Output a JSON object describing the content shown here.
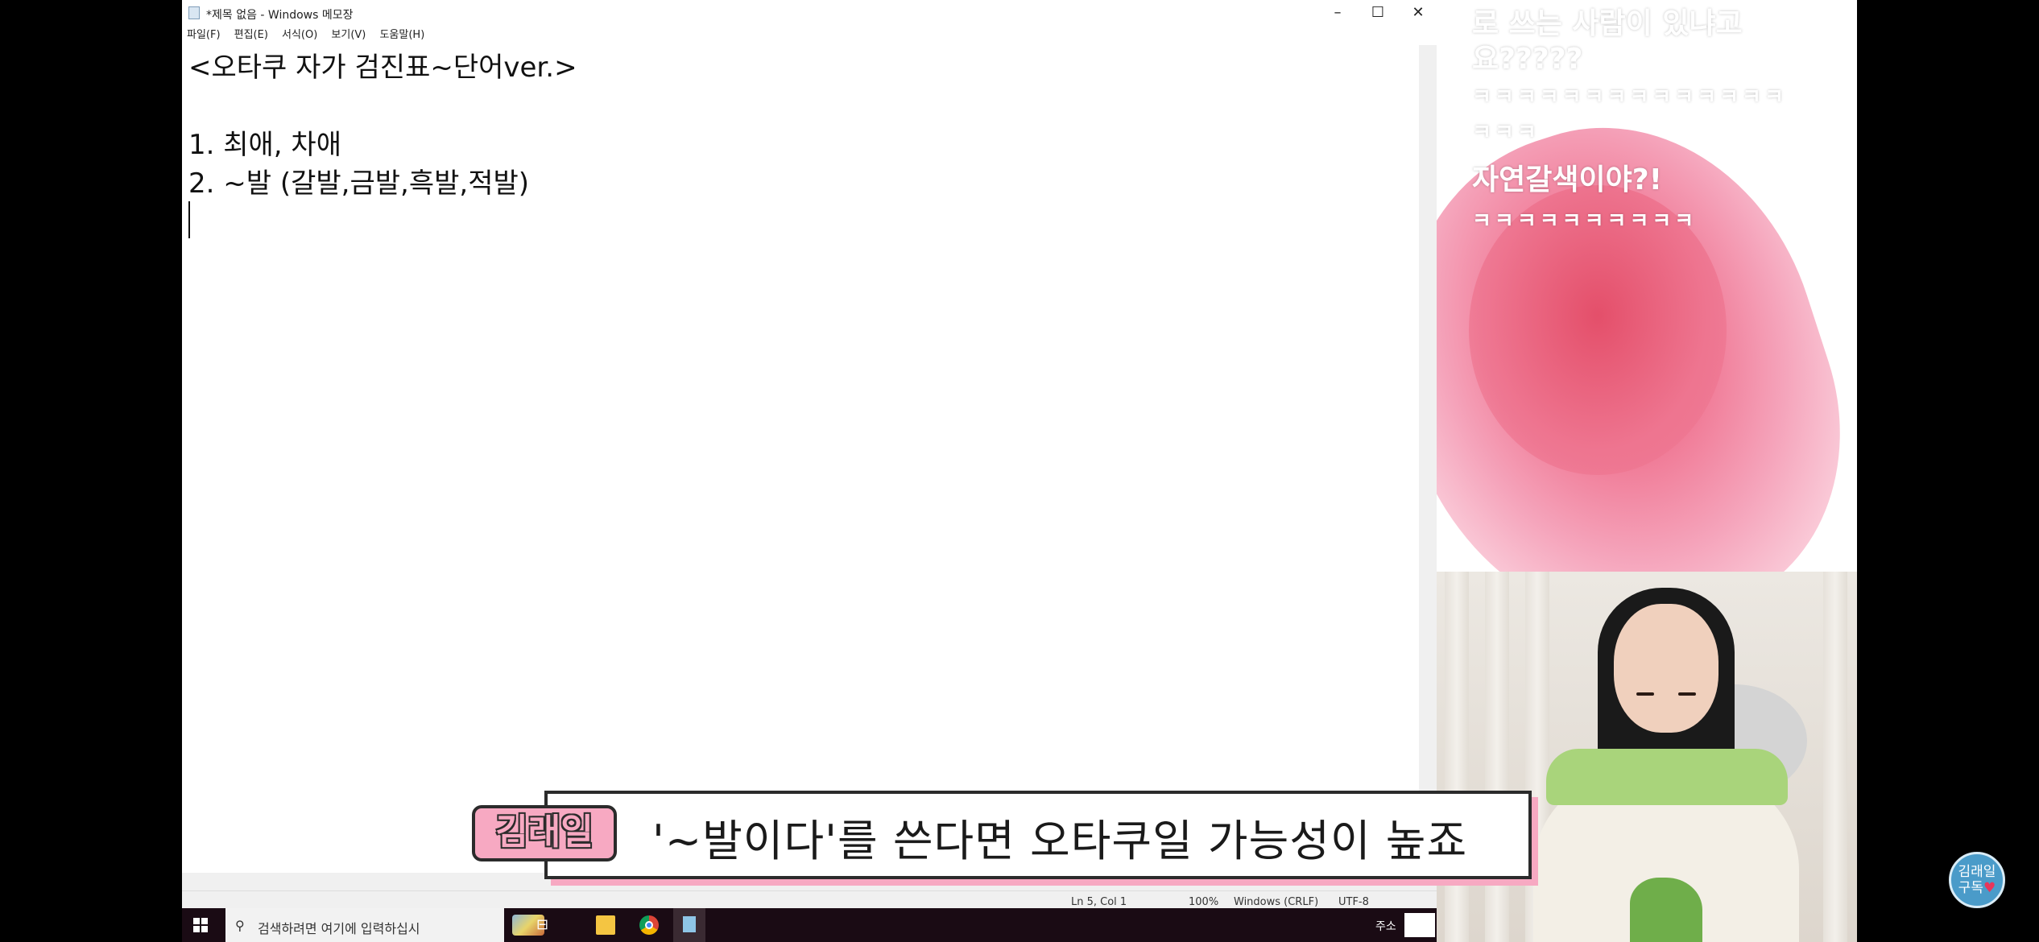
{
  "notepad": {
    "title": "*제목 없음 - Windows 메모장",
    "menu": [
      "파일(F)",
      "편집(E)",
      "서식(O)",
      "보기(V)",
      "도움말(H)"
    ],
    "lines": [
      "<오타쿠 자가 검진표~단어ver.>",
      "",
      "1. 최애, 차애",
      "2. ~발 (갈발,금발,흑발,적발)"
    ],
    "status": {
      "position": "Ln 5, Col 1",
      "zoom": "100%",
      "line_ending": "Windows (CRLF)",
      "encoding": "UTF-8"
    }
  },
  "chat": {
    "lines": [
      "로 쓰는 사람이 있냐고",
      "요?????",
      "ㅋㅋㅋㅋㅋㅋㅋㅋㅋㅋㅋㅋㅋㅋ",
      "ㅋㅋㅋ",
      "자연갈색이야?!",
      "ㅋㅋㅋㅋㅋㅋㅋㅋㅋㅋ"
    ]
  },
  "subtitle": {
    "name": "김래일",
    "text": "'~발이다'를 쓴다면 오타쿠일 가능성이 높죠"
  },
  "taskbar": {
    "search_placeholder": "검색하려면 여기에 입력하십시",
    "ime": "주소"
  },
  "badge": {
    "line1": "김래일",
    "line2": "구독"
  },
  "colors": {
    "accent_pink": "#f7a9c2",
    "taskbar_bg": "#1a0b14",
    "badge_blue": "#4a9bc9"
  }
}
